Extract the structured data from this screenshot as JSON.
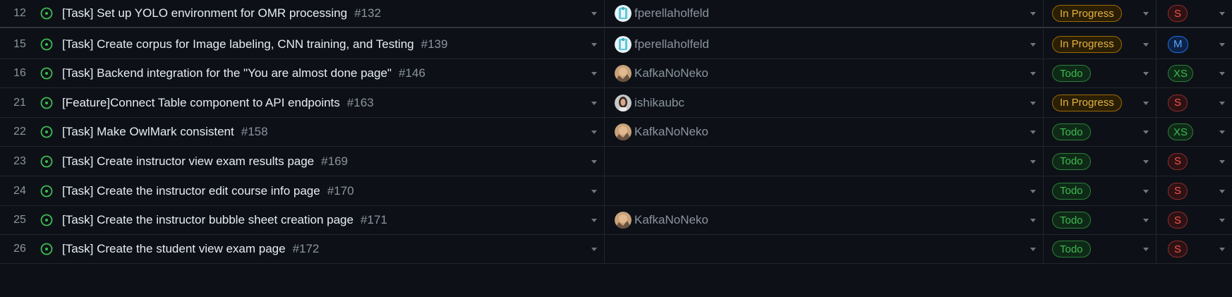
{
  "colors": {
    "background": "#0d1117",
    "open_issue": "#3fb950",
    "in_progress": "#e3b341",
    "todo": "#3fb950",
    "size_s": "#f85149",
    "size_m": "#58a6ff",
    "size_xs": "#3fb950"
  },
  "rows": [
    {
      "num": "12",
      "title": "[Task] Set up YOLO environment for OMR processing",
      "issue": "#132",
      "assignee": "fperellaholfeld",
      "avatar": "robot-avatar",
      "status": "In Progress",
      "size": "S"
    },
    {
      "num": "15",
      "title": "[Task] Create corpus for Image labeling, CNN training, and Testing",
      "issue": "#139",
      "assignee": "fperellaholfeld",
      "avatar": "robot-avatar",
      "status": "In Progress",
      "size": "M"
    },
    {
      "num": "16",
      "title": "[Task] Backend integration for the \"You are almost done page\"",
      "issue": "#146",
      "assignee": "KafkaNoNeko",
      "avatar": "photo-avatar",
      "status": "Todo",
      "size": "XS"
    },
    {
      "num": "21",
      "title": "[Feature]Connect Table component to API endpoints",
      "issue": "#163",
      "assignee": "ishikaubc",
      "avatar": "person-avatar",
      "status": "In Progress",
      "size": "S"
    },
    {
      "num": "22",
      "title": "[Task] Make OwlMark consistent",
      "issue": "#158",
      "assignee": "KafkaNoNeko",
      "avatar": "photo-avatar",
      "status": "Todo",
      "size": "XS"
    },
    {
      "num": "23",
      "title": "[Task] Create instructor view exam results page",
      "issue": "#169",
      "assignee": "",
      "avatar": "",
      "status": "Todo",
      "size": "S"
    },
    {
      "num": "24",
      "title": "[Task] Create the instructor edit course info page",
      "issue": "#170",
      "assignee": "",
      "avatar": "",
      "status": "Todo",
      "size": "S"
    },
    {
      "num": "25",
      "title": "[Task] Create the instructor bubble sheet creation page",
      "issue": "#171",
      "assignee": "KafkaNoNeko",
      "avatar": "photo-avatar",
      "status": "Todo",
      "size": "S"
    },
    {
      "num": "26",
      "title": "[Task] Create the student view exam page",
      "issue": "#172",
      "assignee": "",
      "avatar": "",
      "status": "Todo",
      "size": "S"
    }
  ]
}
